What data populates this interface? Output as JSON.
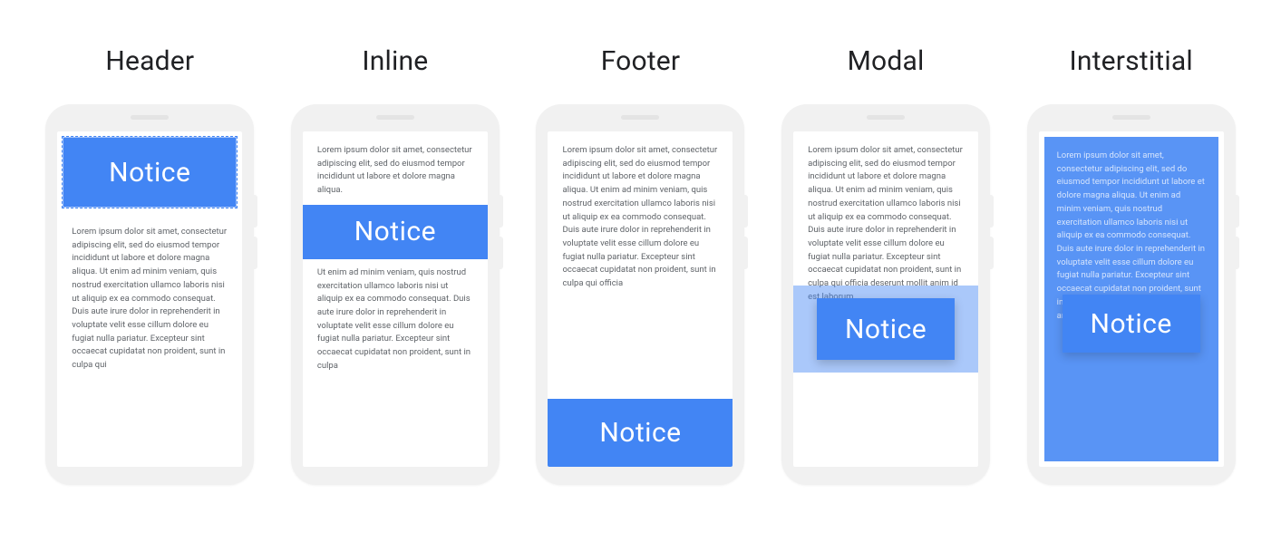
{
  "columns": [
    {
      "title": "Header",
      "notice": "Notice"
    },
    {
      "title": "Inline",
      "notice": "Notice"
    },
    {
      "title": "Footer",
      "notice": "Notice"
    },
    {
      "title": "Modal",
      "notice": "Notice"
    },
    {
      "title": "Interstitial",
      "notice": "Notice"
    }
  ],
  "lorem": {
    "short": "Lorem ipsum dolor sit amet, consectetur adipiscing elit, sed do eiusmod tempor incididunt ut labore et dolore magna aliqua.",
    "header_body": "Lorem ipsum dolor sit amet, consectetur adipiscing elit, sed do eiusmod tempor incididunt ut labore et dolore magna aliqua. Ut enim ad minim veniam, quis nostrud exercitation ullamco laboris nisi ut aliquip ex ea commodo consequat. Duis aute irure dolor in reprehenderit in voluptate velit esse cillum dolore eu fugiat nulla pariatur. Excepteur sint occaecat cupidatat non proident, sunt in culpa qui",
    "inline_bottom": "Ut enim ad minim veniam, quis nostrud exercitation ullamco laboris nisi ut aliquip ex ea commodo consequat. Duis aute irure dolor in reprehenderit in voluptate velit esse cillum dolore eu fugiat nulla pariatur. Excepteur sint occaecat cupidatat non proident, sunt in culpa",
    "footer_body": "Lorem ipsum dolor sit amet, consectetur adipiscing elit, sed do eiusmod tempor incididunt ut labore et dolore magna aliqua. Ut enim ad minim veniam, quis nostrud exercitation ullamco laboris nisi ut aliquip ex ea commodo consequat. Duis aute irure dolor in reprehenderit in voluptate velit esse cillum dolore eu fugiat nulla pariatur. Excepteur sint occaecat cupidatat non proident, sunt in culpa qui officia",
    "modal_body": "Lorem ipsum dolor sit amet, consectetur adipiscing elit, sed do eiusmod tempor incididunt ut labore et dolore magna aliqua. Ut enim ad minim veniam, quis nostrud exercitation ullamco laboris nisi ut aliquip ex ea commodo consequat. Duis aute irure dolor in reprehenderit in voluptate velit esse cillum dolore eu fugiat nulla pariatur. Excepteur sint occaecat cupidatat non proident, sunt in culpa qui officia deserunt mollit anim id est laborum.",
    "interstitial_body": "Lorem ipsum dolor sit amet, consectetur adipiscing elit, sed do eiusmod tempor incididunt ut labore et dolore magna aliqua. Ut enim ad minim veniam, quis nostrud exercitation ullamco laboris nisi ut aliquip ex ea commodo consequat. Duis aute irure dolor in reprehenderit in voluptate velit esse cillum dolore eu fugiat nulla pariatur. Excepteur sint occaecat cupidatat non proident, sunt in culpa qui officia deserunt mollit anim id est laborum."
  }
}
